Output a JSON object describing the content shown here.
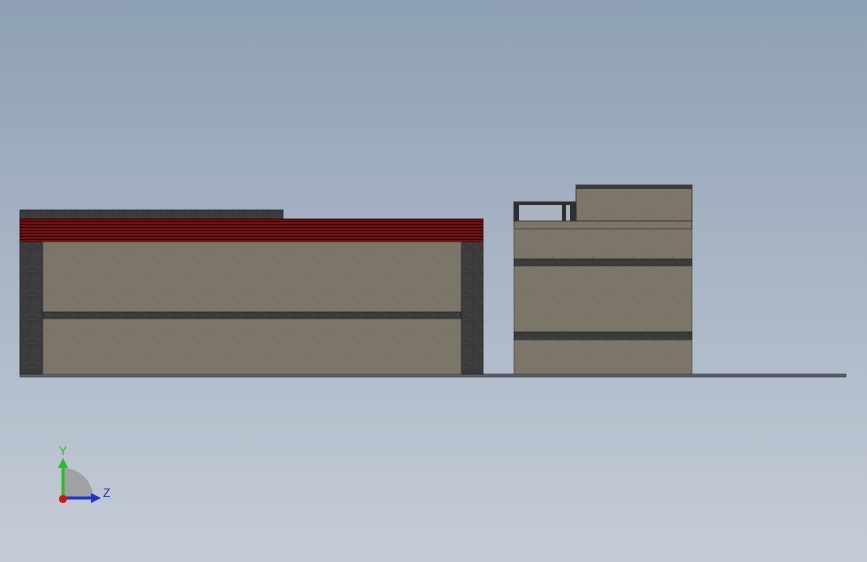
{
  "viewport": {
    "background_top": "#8ea0b5",
    "background_bottom": "#c5ccd7"
  },
  "model": {
    "concrete_color": "#7c7668",
    "dark_masonry_color": "#3b3b3b",
    "roof_tile_color": "#7a0d0d",
    "ground_line_color": "#4a4a4a"
  },
  "triad": {
    "y_label": "Y",
    "z_label": "Z",
    "y_color": "#22c422",
    "z_color": "#2233cc",
    "x_color": "#dd1111"
  }
}
